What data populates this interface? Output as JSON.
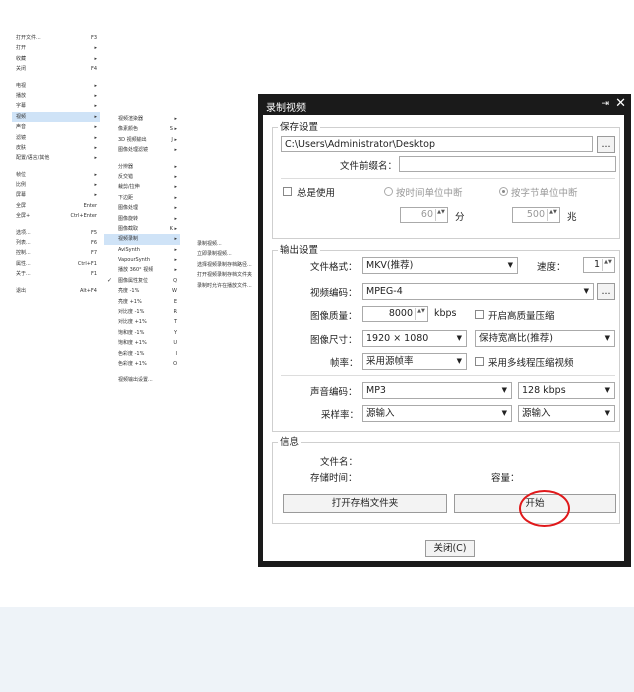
{
  "menu1": {
    "items": [
      {
        "label": "打开文件...",
        "sc": "F3"
      },
      {
        "label": "打开",
        "arrow": "▸"
      },
      {
        "label": "收藏",
        "arrow": "▸"
      },
      {
        "label": "关闭",
        "sc": "F4"
      },
      {
        "gap": true
      },
      {
        "label": "电视",
        "arrow": "▸"
      },
      {
        "label": "播放",
        "arrow": "▸"
      },
      {
        "label": "字幕",
        "arrow": "▸"
      },
      {
        "label": "视频",
        "arrow": "▸",
        "hl": true
      },
      {
        "label": "声音",
        "arrow": "▸"
      },
      {
        "label": "滤镜",
        "arrow": "▸"
      },
      {
        "label": "皮肤",
        "arrow": "▸"
      },
      {
        "label": "配置/语言/其他",
        "arrow": "▸"
      },
      {
        "gap": true
      },
      {
        "label": "帧位",
        "arrow": "▸"
      },
      {
        "label": "比例",
        "arrow": "▸"
      },
      {
        "label": "屏幕",
        "arrow": "▸"
      },
      {
        "label": "全屏",
        "sc": "Enter"
      },
      {
        "label": "全屏+",
        "sc": "Ctrl+Enter"
      },
      {
        "gap": true
      },
      {
        "label": "选项...",
        "sc": "F5"
      },
      {
        "label": "列表...",
        "sc": "F6"
      },
      {
        "label": "控制...",
        "sc": "F7"
      },
      {
        "label": "属性...",
        "sc": "Ctrl+F1"
      },
      {
        "label": "关于...",
        "sc": "F1"
      },
      {
        "gap": true
      },
      {
        "label": "退出",
        "sc": "Alt+F4"
      }
    ]
  },
  "menu2": {
    "items": [
      {
        "label": "视频渲染器",
        "arrow": "▸"
      },
      {
        "label": "像素颜色",
        "sc": "S ▸"
      },
      {
        "label": "3D 视频输出",
        "sc": "J ▸"
      },
      {
        "label": "图像处理滤镜",
        "arrow": "▸"
      },
      {
        "gap": true
      },
      {
        "label": "分辨器",
        "arrow": "▸"
      },
      {
        "label": "反交错",
        "arrow": "▸"
      },
      {
        "label": "裁剪/拉伸",
        "arrow": "▸"
      },
      {
        "label": "下边距",
        "arrow": "▸"
      },
      {
        "label": "图像处理",
        "arrow": "▸"
      },
      {
        "label": "图像旋转",
        "arrow": "▸"
      },
      {
        "label": "图像截取",
        "sc": "K ▸"
      },
      {
        "label": "视频录制",
        "arrow": "▸",
        "hl": true
      },
      {
        "label": "AviSynth",
        "arrow": "▸"
      },
      {
        "label": "VapourSynth",
        "arrow": "▸"
      },
      {
        "label": "播放 360° 视频",
        "arrow": "▸"
      },
      {
        "label": "图像属性复位",
        "sc": "Q",
        "check": "✓"
      },
      {
        "label": "亮度 -1%",
        "sc": "W"
      },
      {
        "label": "亮度 +1%",
        "sc": "E"
      },
      {
        "label": "对比度 -1%",
        "sc": "R"
      },
      {
        "label": "对比度 +1%",
        "sc": "T"
      },
      {
        "label": "饱和度 -1%",
        "sc": "Y"
      },
      {
        "label": "饱和度 +1%",
        "sc": "U"
      },
      {
        "label": "色彩度 -1%",
        "sc": "I"
      },
      {
        "label": "色彩度 +1%",
        "sc": "O"
      },
      {
        "gap": true
      },
      {
        "label": "视频输出设置..."
      }
    ]
  },
  "menu3": {
    "items": [
      {
        "label": "录制视频..."
      },
      {
        "label": "立即录制视频..."
      },
      {
        "label": "选择视频录制存档路径..."
      },
      {
        "label": "打开视频录制存档文件夹"
      },
      {
        "label": "录制时允许在播放文件..."
      }
    ]
  },
  "dialog": {
    "title": "录制视频",
    "pin_icon": "⇥",
    "close_icon": "✕",
    "save_group": "保存设置",
    "path": "C:\\Users\\Administrator\\Desktop",
    "browse": "...",
    "prefix_label": "文件前缀名：",
    "prefix_value": "",
    "always_use": "总是使用",
    "by_time": "按时间单位中断",
    "by_bytes": "按字节单位中断",
    "time_value": "60",
    "time_unit": "分",
    "bytes_value": "500",
    "bytes_unit": "兆",
    "output_group": "输出设置",
    "format_label": "文件格式：",
    "format_value": "MKV(推荐)",
    "speed_label": "速度：",
    "speed_value": "1",
    "vcodec_label": "视频编码：",
    "vcodec_value": "MPEG-4",
    "vcodec_more": "...",
    "quality_label": "图像质量：",
    "quality_value": "8000",
    "quality_unit": "kbps",
    "hq_label": "开启高质量压缩",
    "size_label": "图像尺寸：",
    "size_value": "1920 × 1080",
    "aspect_value": "保持宽高比(推荐)",
    "fps_label": "帧率：",
    "fps_value": "采用源帧率",
    "multithread_label": "采用多线程压缩视频",
    "acodec_label": "声音编码：",
    "acodec_value": "MP3",
    "abitrate_value": "128 kbps",
    "samplerate_label": "采样率：",
    "samplerate_value": "源输入",
    "channels_value": "源输入",
    "info_group": "信息",
    "filename_label": "文件名：",
    "savetime_label": "存储时间：",
    "capacity_label": "容量：",
    "open_folder": "打开存档文件夹",
    "start": "开始",
    "close_btn": "关闭(C)",
    "dropdown_icon": "▼",
    "spin_icon": "▲▼"
  },
  "colors": {
    "highlight": "#cfe3f7",
    "annotation_ring": "#e0191b",
    "footer_band": "#eef3f8"
  }
}
